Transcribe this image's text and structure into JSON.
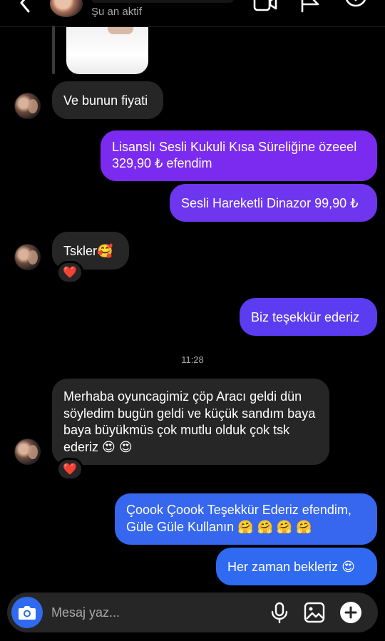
{
  "header": {
    "status": "Şu an aktif",
    "icons": [
      "chevron-left-icon",
      "video-call-icon",
      "flag-icon",
      "info-icon"
    ]
  },
  "messages": [
    {
      "side": "in",
      "text": "Ve bunun fiyati"
    },
    {
      "side": "out",
      "text": "Lisanslı Sesli Kukuli Kısa Süreliğine özeeel 329,90 ₺ efendim"
    },
    {
      "side": "out",
      "text": "Sesli Hareketli Dinazor 99,90 ₺"
    },
    {
      "side": "in",
      "text": "Tskler",
      "emoji": "🥰",
      "reaction": "❤️"
    },
    {
      "side": "out",
      "text": "Biz teşekkür ederiz"
    },
    {
      "side": "in",
      "text": "Merhaba oyuncagimiz çöp Aracı geldi dün söyledim bugün geldi ve küçük sandım baya baya büyükmüs çok mutlu olduk çok tsk ederiz",
      "emoji": "😍 😍",
      "reaction": "❤️"
    },
    {
      "side": "out",
      "text": "Çoook Çoook Teşekkür Ederiz efendim, Güle Güle Kullanın",
      "emoji": "🤗 🤗 🤗 🤗"
    },
    {
      "side": "out",
      "text": "Her zaman bekleriz",
      "emoji": "😍"
    }
  ],
  "timestamp": "11:28",
  "composer": {
    "placeholder": "Mesaj yaz..."
  },
  "colors": {
    "background": "#000000",
    "incoming_bubble": "#262626",
    "outgoing_gradient_top": "#7b2bf0",
    "outgoing_gradient_bottom": "#2f6af0",
    "reaction_heart": "#e0245e"
  }
}
